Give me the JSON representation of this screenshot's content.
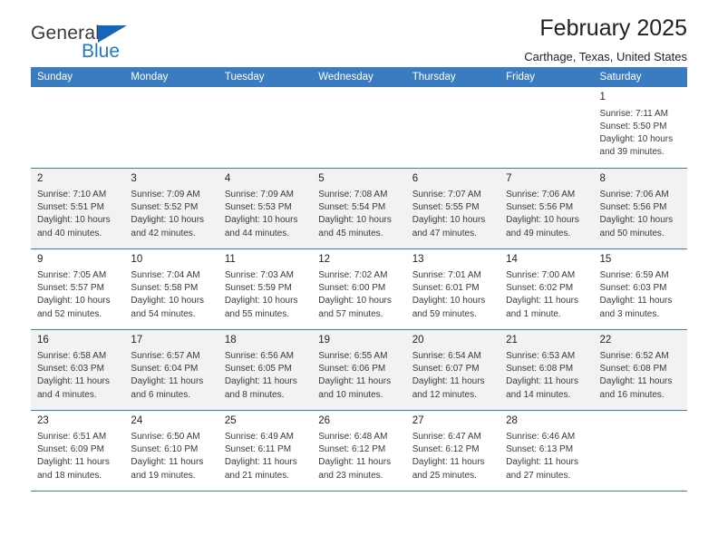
{
  "brand": {
    "word_one": "General",
    "word_two": "Blue",
    "accent_color": "#1f7bc4",
    "triangle_color": "#1565b8"
  },
  "header": {
    "title": "February 2025",
    "subtitle": "Carthage, Texas, United States"
  },
  "calendar": {
    "header_bg": "#3b7cc0",
    "weekdays": [
      "Sunday",
      "Monday",
      "Tuesday",
      "Wednesday",
      "Thursday",
      "Friday",
      "Saturday"
    ],
    "labels": {
      "sunrise": "Sunrise:",
      "sunset": "Sunset:",
      "daylight": "Daylight:"
    },
    "weeks": [
      {
        "shaded": false,
        "days": [
          {
            "empty": true
          },
          {
            "empty": true
          },
          {
            "empty": true
          },
          {
            "empty": true
          },
          {
            "empty": true
          },
          {
            "empty": true
          },
          {
            "empty": false,
            "num": "1",
            "sunrise": "Sunrise: 7:11 AM",
            "sunset": "Sunset: 5:50 PM",
            "daylight_1": "Daylight: 10 hours",
            "daylight_2": "and 39 minutes."
          }
        ]
      },
      {
        "shaded": true,
        "days": [
          {
            "empty": false,
            "num": "2",
            "sunrise": "Sunrise: 7:10 AM",
            "sunset": "Sunset: 5:51 PM",
            "daylight_1": "Daylight: 10 hours",
            "daylight_2": "and 40 minutes."
          },
          {
            "empty": false,
            "num": "3",
            "sunrise": "Sunrise: 7:09 AM",
            "sunset": "Sunset: 5:52 PM",
            "daylight_1": "Daylight: 10 hours",
            "daylight_2": "and 42 minutes."
          },
          {
            "empty": false,
            "num": "4",
            "sunrise": "Sunrise: 7:09 AM",
            "sunset": "Sunset: 5:53 PM",
            "daylight_1": "Daylight: 10 hours",
            "daylight_2": "and 44 minutes."
          },
          {
            "empty": false,
            "num": "5",
            "sunrise": "Sunrise: 7:08 AM",
            "sunset": "Sunset: 5:54 PM",
            "daylight_1": "Daylight: 10 hours",
            "daylight_2": "and 45 minutes."
          },
          {
            "empty": false,
            "num": "6",
            "sunrise": "Sunrise: 7:07 AM",
            "sunset": "Sunset: 5:55 PM",
            "daylight_1": "Daylight: 10 hours",
            "daylight_2": "and 47 minutes."
          },
          {
            "empty": false,
            "num": "7",
            "sunrise": "Sunrise: 7:06 AM",
            "sunset": "Sunset: 5:56 PM",
            "daylight_1": "Daylight: 10 hours",
            "daylight_2": "and 49 minutes."
          },
          {
            "empty": false,
            "num": "8",
            "sunrise": "Sunrise: 7:06 AM",
            "sunset": "Sunset: 5:56 PM",
            "daylight_1": "Daylight: 10 hours",
            "daylight_2": "and 50 minutes."
          }
        ]
      },
      {
        "shaded": false,
        "days": [
          {
            "empty": false,
            "num": "9",
            "sunrise": "Sunrise: 7:05 AM",
            "sunset": "Sunset: 5:57 PM",
            "daylight_1": "Daylight: 10 hours",
            "daylight_2": "and 52 minutes."
          },
          {
            "empty": false,
            "num": "10",
            "sunrise": "Sunrise: 7:04 AM",
            "sunset": "Sunset: 5:58 PM",
            "daylight_1": "Daylight: 10 hours",
            "daylight_2": "and 54 minutes."
          },
          {
            "empty": false,
            "num": "11",
            "sunrise": "Sunrise: 7:03 AM",
            "sunset": "Sunset: 5:59 PM",
            "daylight_1": "Daylight: 10 hours",
            "daylight_2": "and 55 minutes."
          },
          {
            "empty": false,
            "num": "12",
            "sunrise": "Sunrise: 7:02 AM",
            "sunset": "Sunset: 6:00 PM",
            "daylight_1": "Daylight: 10 hours",
            "daylight_2": "and 57 minutes."
          },
          {
            "empty": false,
            "num": "13",
            "sunrise": "Sunrise: 7:01 AM",
            "sunset": "Sunset: 6:01 PM",
            "daylight_1": "Daylight: 10 hours",
            "daylight_2": "and 59 minutes."
          },
          {
            "empty": false,
            "num": "14",
            "sunrise": "Sunrise: 7:00 AM",
            "sunset": "Sunset: 6:02 PM",
            "daylight_1": "Daylight: 11 hours",
            "daylight_2": "and 1 minute."
          },
          {
            "empty": false,
            "num": "15",
            "sunrise": "Sunrise: 6:59 AM",
            "sunset": "Sunset: 6:03 PM",
            "daylight_1": "Daylight: 11 hours",
            "daylight_2": "and 3 minutes."
          }
        ]
      },
      {
        "shaded": true,
        "days": [
          {
            "empty": false,
            "num": "16",
            "sunrise": "Sunrise: 6:58 AM",
            "sunset": "Sunset: 6:03 PM",
            "daylight_1": "Daylight: 11 hours",
            "daylight_2": "and 4 minutes."
          },
          {
            "empty": false,
            "num": "17",
            "sunrise": "Sunrise: 6:57 AM",
            "sunset": "Sunset: 6:04 PM",
            "daylight_1": "Daylight: 11 hours",
            "daylight_2": "and 6 minutes."
          },
          {
            "empty": false,
            "num": "18",
            "sunrise": "Sunrise: 6:56 AM",
            "sunset": "Sunset: 6:05 PM",
            "daylight_1": "Daylight: 11 hours",
            "daylight_2": "and 8 minutes."
          },
          {
            "empty": false,
            "num": "19",
            "sunrise": "Sunrise: 6:55 AM",
            "sunset": "Sunset: 6:06 PM",
            "daylight_1": "Daylight: 11 hours",
            "daylight_2": "and 10 minutes."
          },
          {
            "empty": false,
            "num": "20",
            "sunrise": "Sunrise: 6:54 AM",
            "sunset": "Sunset: 6:07 PM",
            "daylight_1": "Daylight: 11 hours",
            "daylight_2": "and 12 minutes."
          },
          {
            "empty": false,
            "num": "21",
            "sunrise": "Sunrise: 6:53 AM",
            "sunset": "Sunset: 6:08 PM",
            "daylight_1": "Daylight: 11 hours",
            "daylight_2": "and 14 minutes."
          },
          {
            "empty": false,
            "num": "22",
            "sunrise": "Sunrise: 6:52 AM",
            "sunset": "Sunset: 6:08 PM",
            "daylight_1": "Daylight: 11 hours",
            "daylight_2": "and 16 minutes."
          }
        ]
      },
      {
        "shaded": false,
        "days": [
          {
            "empty": false,
            "num": "23",
            "sunrise": "Sunrise: 6:51 AM",
            "sunset": "Sunset: 6:09 PM",
            "daylight_1": "Daylight: 11 hours",
            "daylight_2": "and 18 minutes."
          },
          {
            "empty": false,
            "num": "24",
            "sunrise": "Sunrise: 6:50 AM",
            "sunset": "Sunset: 6:10 PM",
            "daylight_1": "Daylight: 11 hours",
            "daylight_2": "and 19 minutes."
          },
          {
            "empty": false,
            "num": "25",
            "sunrise": "Sunrise: 6:49 AM",
            "sunset": "Sunset: 6:11 PM",
            "daylight_1": "Daylight: 11 hours",
            "daylight_2": "and 21 minutes."
          },
          {
            "empty": false,
            "num": "26",
            "sunrise": "Sunrise: 6:48 AM",
            "sunset": "Sunset: 6:12 PM",
            "daylight_1": "Daylight: 11 hours",
            "daylight_2": "and 23 minutes."
          },
          {
            "empty": false,
            "num": "27",
            "sunrise": "Sunrise: 6:47 AM",
            "sunset": "Sunset: 6:12 PM",
            "daylight_1": "Daylight: 11 hours",
            "daylight_2": "and 25 minutes."
          },
          {
            "empty": false,
            "num": "28",
            "sunrise": "Sunrise: 6:46 AM",
            "sunset": "Sunset: 6:13 PM",
            "daylight_1": "Daylight: 11 hours",
            "daylight_2": "and 27 minutes."
          },
          {
            "empty": true
          }
        ]
      }
    ]
  }
}
